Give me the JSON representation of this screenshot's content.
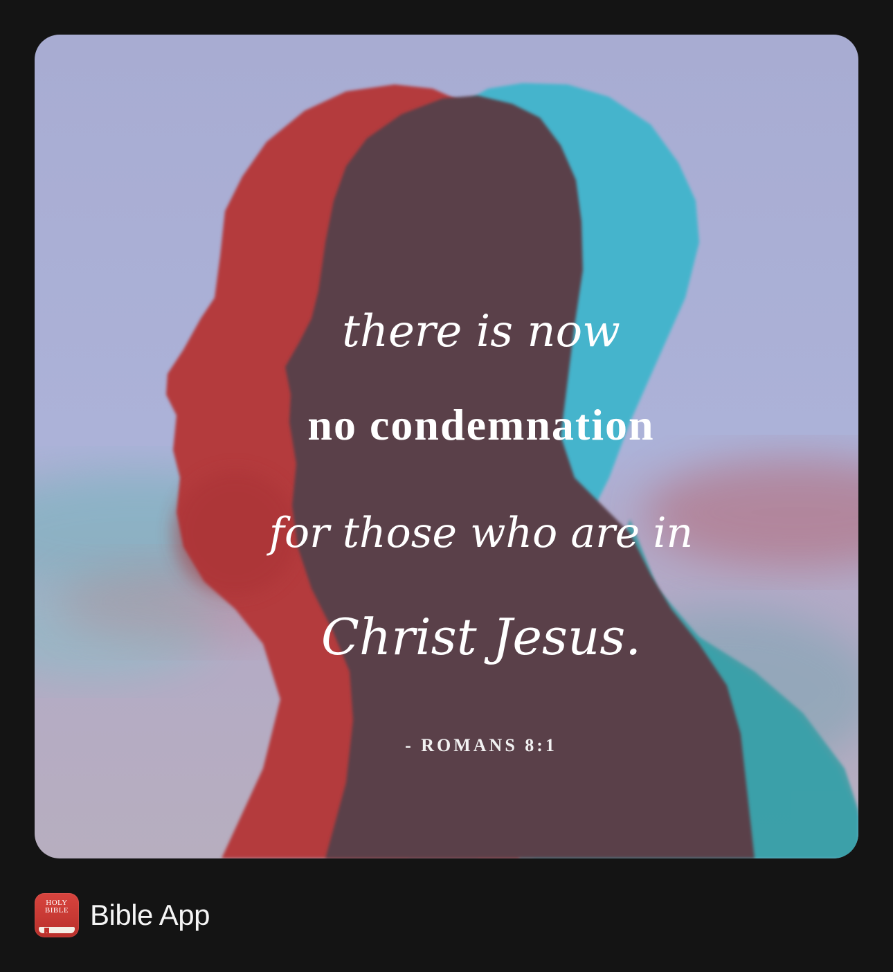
{
  "verse_card": {
    "line1": "there is now",
    "line2": "no condemnation",
    "line3": "for those who are in",
    "line4": "Christ Jesus.",
    "reference": "- ROMANS 8:1"
  },
  "app": {
    "icon_text_line1": "HOLY",
    "icon_text_line2": "BIBLE",
    "name": "Bible App"
  },
  "colors": {
    "background": "#141414",
    "silhouette_red": "#b43a3c",
    "silhouette_cyan": "#3fb5cc",
    "silhouette_overlap": "#5a3f49",
    "sky": "#a9aed6",
    "app_icon_red": "#c83a34"
  }
}
